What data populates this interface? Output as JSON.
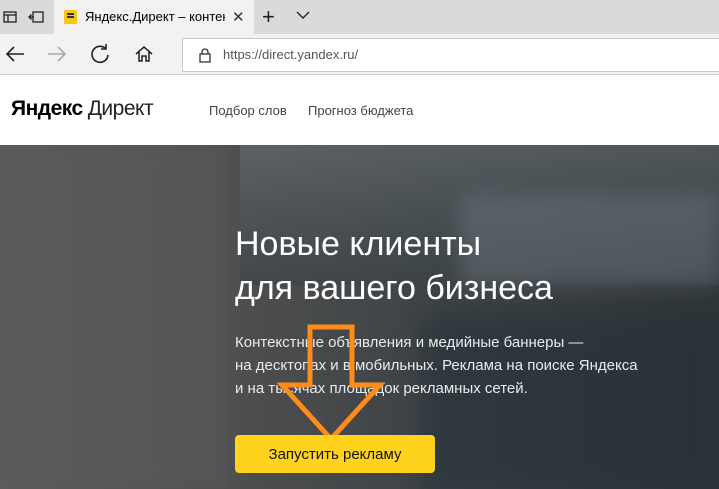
{
  "browser": {
    "tab_title": "Яндекс.Директ – контекстная реклама",
    "tab_close": "✕",
    "new_tab": "+",
    "url": "https://direct.yandex.ru/"
  },
  "site": {
    "logo_brand": "Яндекс",
    "logo_product": "Директ",
    "nav": [
      "Подбор слов",
      "Прогноз бюджета"
    ]
  },
  "hero": {
    "title_lines": [
      "Новые клиенты",
      "для вашего бизнеса"
    ],
    "subtitle_lines": [
      "Контекстные объявления и медийные баннеры —",
      "на десктопах и в мобильных. Реклама на поиске Яндекса",
      "и на тысячах площадок рекламных сетей."
    ],
    "cta_label": "Запустить рекламу"
  },
  "colors": {
    "cta": "#ffd21e",
    "annotation_arrow": "#ff8c1a"
  }
}
